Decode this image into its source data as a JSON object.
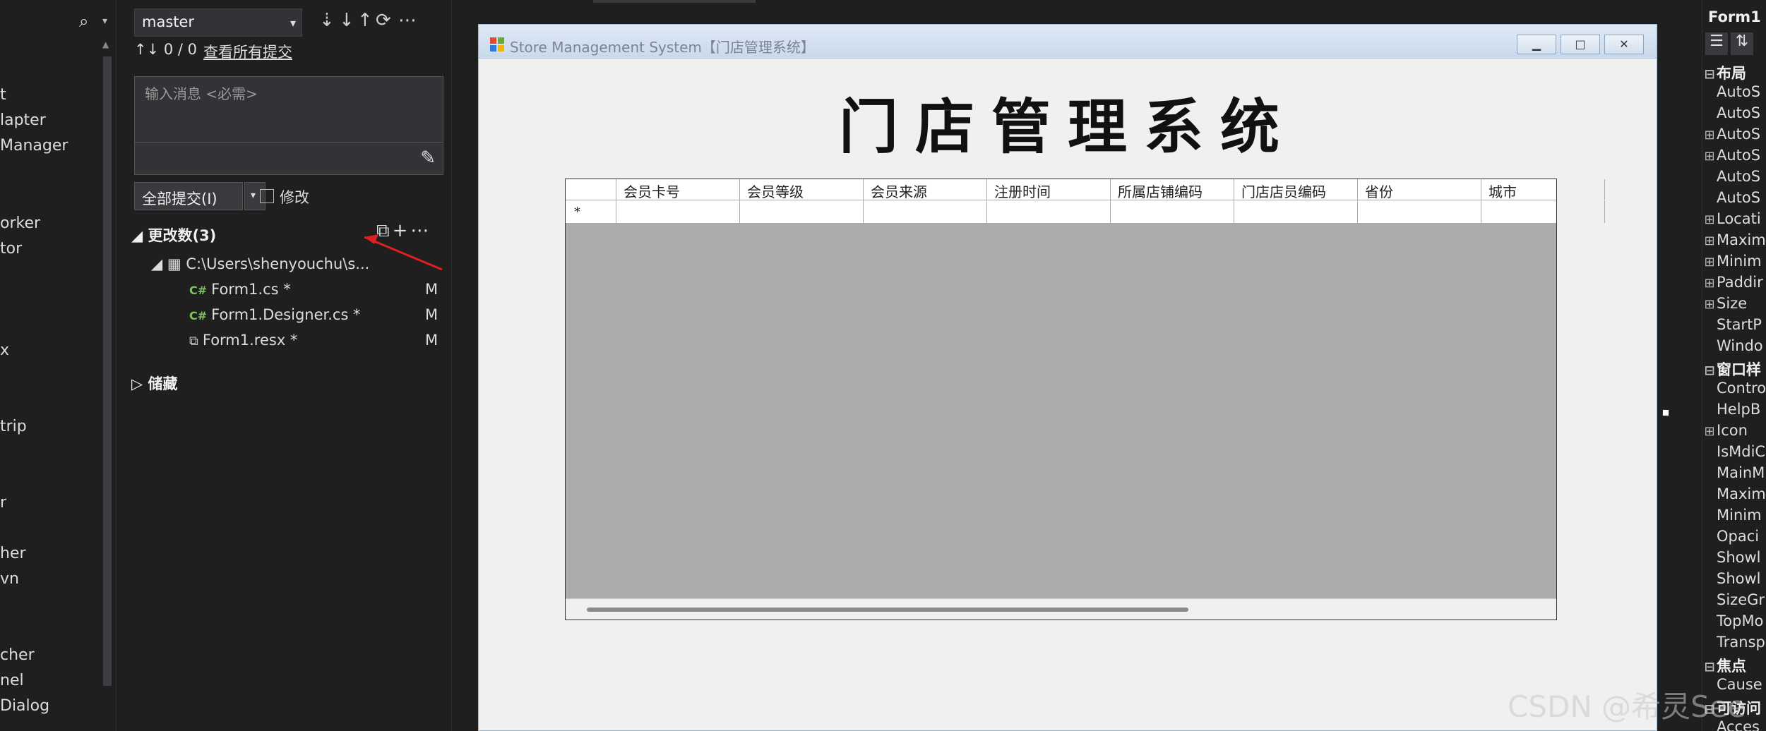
{
  "toolbox": {
    "items": [
      "t",
      "lapter",
      "Manager",
      "orker",
      "tor",
      "x",
      "trip",
      "r",
      "her",
      "vn",
      "cher",
      "nel",
      "Dialog"
    ]
  },
  "git": {
    "branch": "master",
    "sync_count": "↑↓ 0 / 0",
    "view_all": "查看所有提交",
    "message_placeholder": "输入消息 <必需>",
    "commit_all": "全部提交(I)",
    "amend": "修改",
    "changes_header": "更改数(3)",
    "repo_path": "C:\\Users\\shenyouchu\\s...",
    "files": [
      {
        "name": "Form1.cs *",
        "type": "C#",
        "status": "M"
      },
      {
        "name": "Form1.Designer.cs *",
        "type": "C#",
        "status": "M"
      },
      {
        "name": "Form1.resx *",
        "type": "resx",
        "status": "M"
      }
    ],
    "stash": "储藏"
  },
  "form": {
    "window_title": "Store Management System【门店管理系统】",
    "heading": "门店管理系统",
    "grid_columns": [
      "会员卡号",
      "会员等级",
      "会员来源",
      "注册时间",
      "所属店铺编码",
      "门店店员编码",
      "省份",
      "城市"
    ],
    "new_row_marker": "*"
  },
  "properties": {
    "title": "Form1",
    "rows": [
      {
        "label": "布局",
        "type": "cat",
        "pm": "⊟"
      },
      {
        "label": "AutoS",
        "type": "prop",
        "pm": ""
      },
      {
        "label": "AutoS",
        "type": "prop",
        "pm": ""
      },
      {
        "label": "AutoS",
        "type": "prop",
        "pm": "⊞"
      },
      {
        "label": "AutoS",
        "type": "prop",
        "pm": "⊞"
      },
      {
        "label": "AutoS",
        "type": "prop",
        "pm": ""
      },
      {
        "label": "AutoS",
        "type": "prop",
        "pm": ""
      },
      {
        "label": "Locati",
        "type": "prop",
        "pm": "⊞"
      },
      {
        "label": "Maxim",
        "type": "prop",
        "pm": "⊞"
      },
      {
        "label": "Minim",
        "type": "prop",
        "pm": "⊞"
      },
      {
        "label": "Paddir",
        "type": "prop",
        "pm": "⊞"
      },
      {
        "label": "Size",
        "type": "prop",
        "pm": "⊞"
      },
      {
        "label": "StartP",
        "type": "prop",
        "pm": ""
      },
      {
        "label": "Windo",
        "type": "prop",
        "pm": ""
      },
      {
        "label": "窗口样",
        "type": "cat",
        "pm": "⊟"
      },
      {
        "label": "Contro",
        "type": "prop",
        "pm": ""
      },
      {
        "label": "HelpB",
        "type": "prop",
        "pm": ""
      },
      {
        "label": "Icon",
        "type": "prop",
        "pm": "⊞"
      },
      {
        "label": "IsMdiC",
        "type": "prop",
        "pm": ""
      },
      {
        "label": "MainM",
        "type": "prop",
        "pm": ""
      },
      {
        "label": "Maxim",
        "type": "prop",
        "pm": ""
      },
      {
        "label": "Minim",
        "type": "prop",
        "pm": ""
      },
      {
        "label": "Opaci",
        "type": "prop",
        "pm": ""
      },
      {
        "label": "Showl",
        "type": "prop",
        "pm": ""
      },
      {
        "label": "Showl",
        "type": "prop",
        "pm": ""
      },
      {
        "label": "SizeGr",
        "type": "prop",
        "pm": ""
      },
      {
        "label": "TopMo",
        "type": "prop",
        "pm": ""
      },
      {
        "label": "Transp",
        "type": "prop",
        "pm": ""
      },
      {
        "label": "焦点",
        "type": "cat",
        "pm": "⊟"
      },
      {
        "label": "Cause",
        "type": "prop",
        "pm": ""
      },
      {
        "label": "可访问",
        "type": "cat",
        "pm": "⊟"
      },
      {
        "label": "Acces",
        "type": "prop",
        "pm": ""
      }
    ]
  },
  "watermark": "CSDN @希灵See"
}
